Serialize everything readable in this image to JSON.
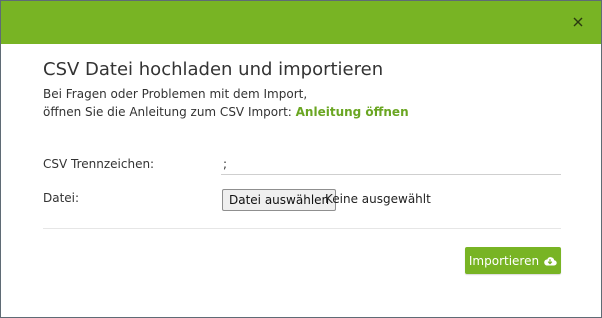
{
  "modal": {
    "title": "CSV Datei hochladen und importieren",
    "intro_line1": "Bei Fragen oder Problemen mit dem Import,",
    "intro_line2_prefix": "öffnen Sie die Anleitung zum CSV Import: ",
    "help_link_label": "Anleitung öffnen",
    "close_icon": "close-icon",
    "colors": {
      "header": "#78b424",
      "link": "#6aa622",
      "button": "#78b424"
    }
  },
  "form": {
    "separator_label": "CSV Trennzeichen:",
    "separator_value": ";",
    "file_label": "Datei:",
    "file_button_label": "Datei auswählen",
    "file_status": "Keine ausgewählt"
  },
  "actions": {
    "import_label": "Importieren",
    "import_icon": "cloud-download-icon"
  }
}
